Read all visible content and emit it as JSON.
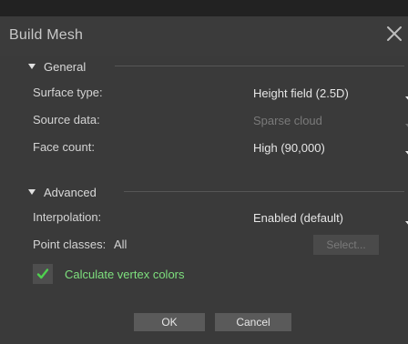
{
  "dialog": {
    "title": "Build Mesh",
    "sections": {
      "general": {
        "title": "General",
        "rows": [
          {
            "label": "Surface type:",
            "value": "Height field (2.5D)",
            "enabled": true
          },
          {
            "label": "Source data:",
            "value": "Sparse cloud",
            "enabled": false
          },
          {
            "label": "Face count:",
            "value": "High (90,000)",
            "enabled": true
          }
        ]
      },
      "advanced": {
        "title": "Advanced",
        "interpolation": {
          "label": "Interpolation:",
          "value": "Enabled (default)"
        },
        "point_classes": {
          "label": "Point classes:",
          "value": "All",
          "select_button": "Select..."
        },
        "vertex_colors": {
          "label": "Calculate vertex colors",
          "checked": true
        }
      }
    },
    "buttons": {
      "ok": "OK",
      "cancel": "Cancel"
    }
  }
}
